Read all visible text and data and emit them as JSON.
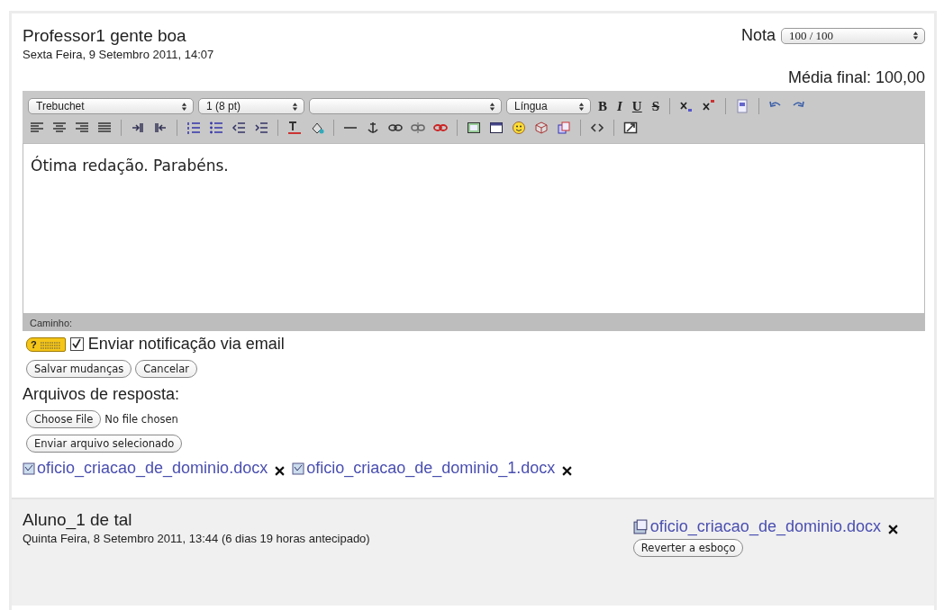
{
  "teacher": {
    "name": "Professor1 gente boa",
    "date": "Sexta Feira, 9 Setembro 2011, 14:07",
    "grade_label": "Nota",
    "grade_value": "100 / 100",
    "final_grade": "Média final: 100,00"
  },
  "editor": {
    "font": "Trebuchet",
    "size": "1 (8 pt)",
    "language": "Língua",
    "format_buttons": [
      "B",
      "I",
      "U",
      "S"
    ],
    "content": "Ótima redação. Parabéns.",
    "path_label": "Caminho:"
  },
  "help_badge": "?",
  "notify": {
    "label": "Enviar notificação via email",
    "checked": true
  },
  "buttons": [
    "Salvar mudanças",
    "Cancelar"
  ],
  "response_files": {
    "title": "Arquivos de resposta:",
    "choose_button": "Choose File",
    "no_file": "No file chosen",
    "upload_button": "Enviar arquivo selecionado",
    "files": [
      "oficio_criacao_de_dominio.docx",
      "oficio_criacao_de_dominio_1.docx"
    ]
  },
  "student": {
    "name": "Aluno_1 de tal",
    "date": "Quinta Feira, 8 Setembro 2011, 13:44 (6 dias 19 horas antecipado)",
    "file": "oficio_criacao_de_dominio.docx",
    "revert_button": "Reverter a esboço"
  }
}
